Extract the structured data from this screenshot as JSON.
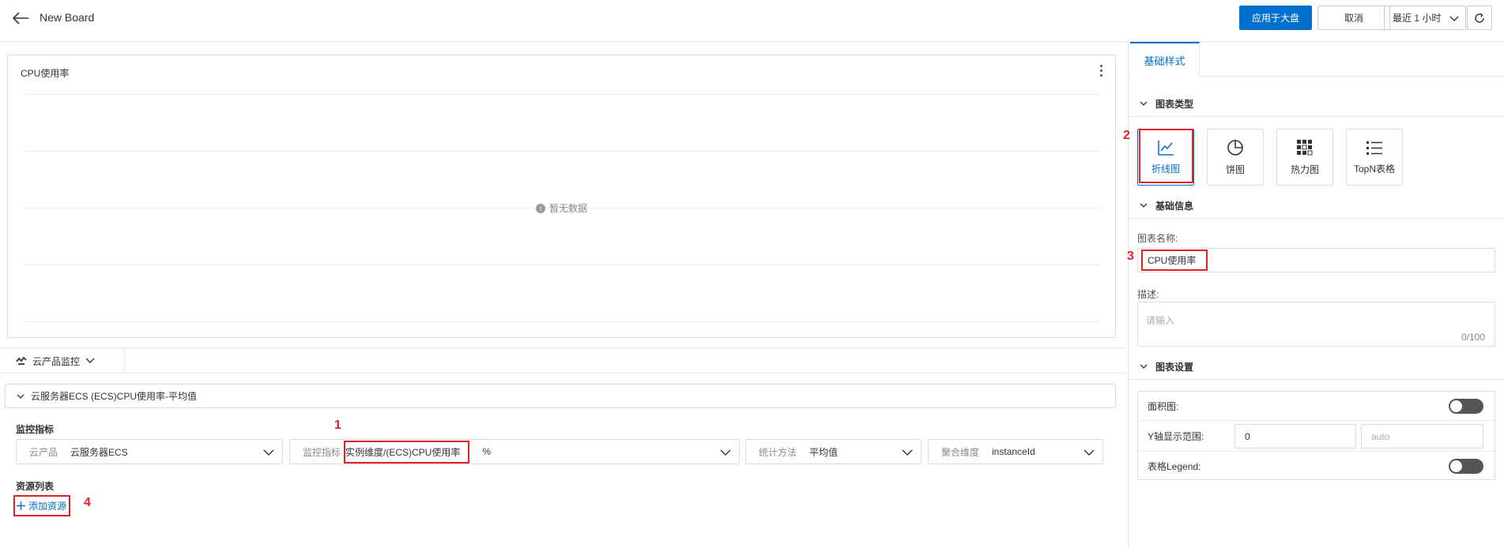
{
  "header": {
    "title": "New Board",
    "apply_label": "应用于大盘",
    "cancel_label": "取消",
    "time_range": "最近 1 小时"
  },
  "chart_card": {
    "title": "CPU使用率",
    "empty_text": "暂无数据"
  },
  "source_tab": {
    "label": "云产品监控"
  },
  "metric_group": {
    "title": "云服务器ECS (ECS)CPU使用率-平均值",
    "section_label": "监控指标",
    "fields": {
      "product_label": "云产品",
      "product_value": "云服务器ECS",
      "metric_label": "监控指标",
      "metric_value": "实例维度/(ECS)CPU使用率",
      "metric_unit": "%",
      "stat_label": "统计方法",
      "stat_value": "平均值",
      "agg_label": "聚合维度",
      "agg_value": "instanceId"
    }
  },
  "resources": {
    "section_label": "资源列表",
    "add_label": "添加资源"
  },
  "right_panel": {
    "tab_label": "基础样式",
    "chart_type_section": "图表类型",
    "chart_types": [
      {
        "label": "折线图",
        "icon": "line-chart-icon",
        "active": true
      },
      {
        "label": "饼图",
        "icon": "pie-chart-icon",
        "active": false
      },
      {
        "label": "热力图",
        "icon": "heatmap-icon",
        "active": false
      },
      {
        "label": "TopN表格",
        "icon": "list-icon",
        "active": false
      }
    ],
    "basic_info_section": "基础信息",
    "name_label": "图表名称:",
    "name_value": "CPU使用率",
    "desc_label": "描述:",
    "desc_placeholder": "请输入",
    "desc_count": "0/100",
    "settings_section": "图表设置",
    "area_label": "面积图:",
    "y_range_label": "Y轴显示范围:",
    "y_min": "0",
    "y_max_placeholder": "auto",
    "legend_label": "表格Legend:"
  },
  "annotations": {
    "n1": "1",
    "n2": "2",
    "n3": "3",
    "n4": "4"
  },
  "colors": {
    "primary": "#0070cc",
    "annotation": "#e0212a",
    "toggle_off": "#555555"
  }
}
